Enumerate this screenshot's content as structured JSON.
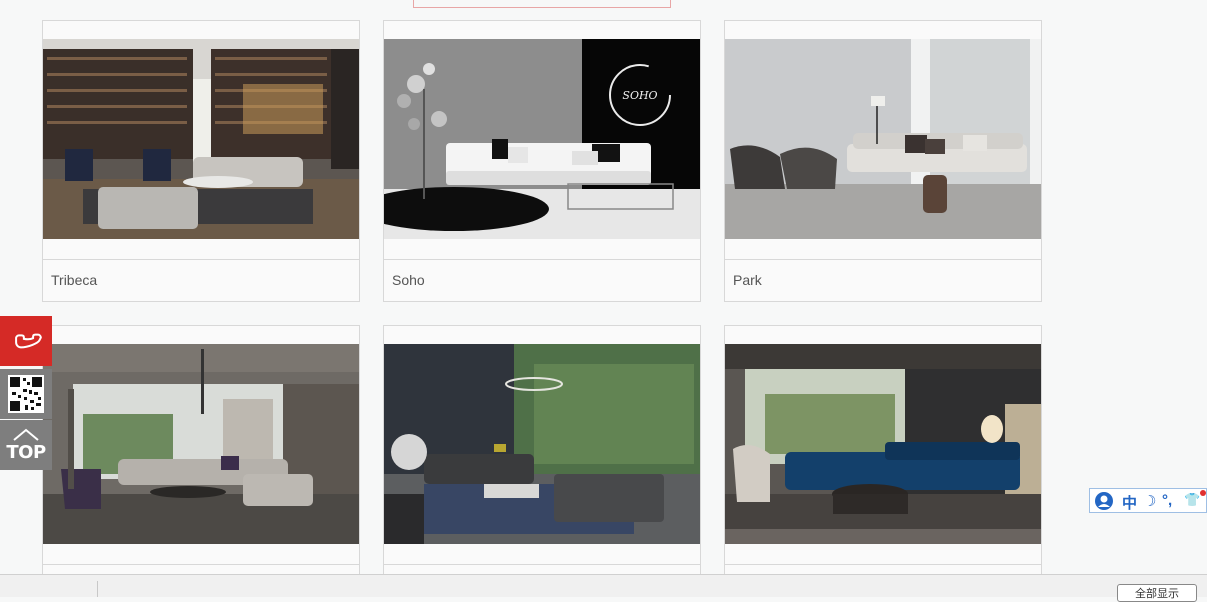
{
  "products": [
    {
      "name": "Tribeca"
    },
    {
      "name": "Soho",
      "sign_text": "SOHO"
    },
    {
      "name": "Park"
    },
    {
      "name": ""
    },
    {
      "name": ""
    },
    {
      "name": ""
    }
  ],
  "sidebar": {
    "phone_icon": "phone-icon",
    "qr_icon": "qr-code-icon",
    "top_label": "TOP"
  },
  "ime_toolbar": {
    "items": [
      "中",
      "☽",
      "°,",
      "👕"
    ]
  },
  "bottom_bar": {
    "button_label": "全部显示"
  },
  "colors": {
    "phone_bg": "#d52a26",
    "side_bg": "#7e7e7e",
    "ime_accent": "#2366c4"
  }
}
